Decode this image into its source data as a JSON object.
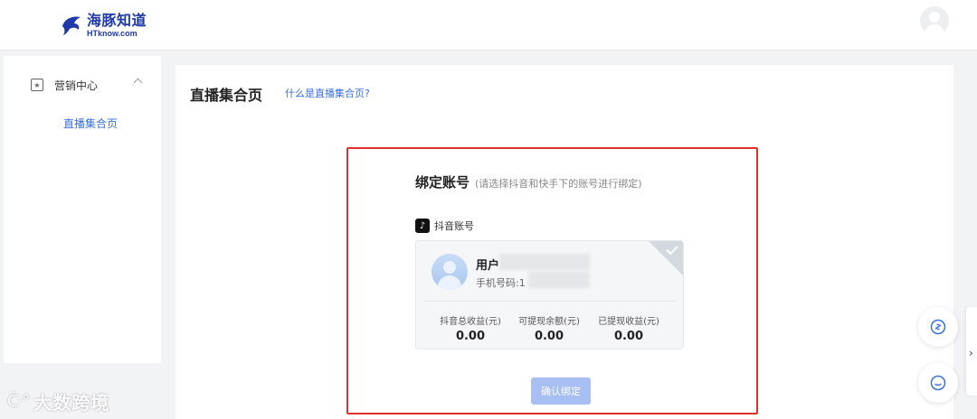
{
  "header": {
    "logo_cn": "海豚知道",
    "logo_en": "HTknow.com"
  },
  "sidebar": {
    "group_label": "营销中心",
    "items": [
      {
        "label": "直播集合页",
        "active": true
      }
    ]
  },
  "main": {
    "title": "直播集合页",
    "help_link": "什么是直播集合页?"
  },
  "bind": {
    "title": "绑定账号",
    "hint": "(请选择抖音和快手下的账号进行绑定)",
    "platform_label": "抖音账号",
    "card": {
      "user_prefix": "用户",
      "phone_prefix": "手机号码:1",
      "selected": true,
      "stats": [
        {
          "label": "抖音总收益(元)",
          "value": "0.00"
        },
        {
          "label": "可提现余额(元)",
          "value": "0.00"
        },
        {
          "label": "已提现收益(元)",
          "value": "0.00"
        }
      ]
    },
    "confirm_label": "确认绑定"
  },
  "watermark": {
    "text": "大数跨境"
  },
  "colors": {
    "brand": "#1f3aa8",
    "accent": "#3a6fe0",
    "highlight": "#e0312f",
    "button_disabled": "#a8bff3"
  },
  "icons": {
    "menu": "star-box-icon",
    "collapse": "chevron-up-icon",
    "platform": "douyin-icon",
    "float_1": "link-icon",
    "float_2": "chat-icon",
    "side": "chevron-right-icon"
  }
}
